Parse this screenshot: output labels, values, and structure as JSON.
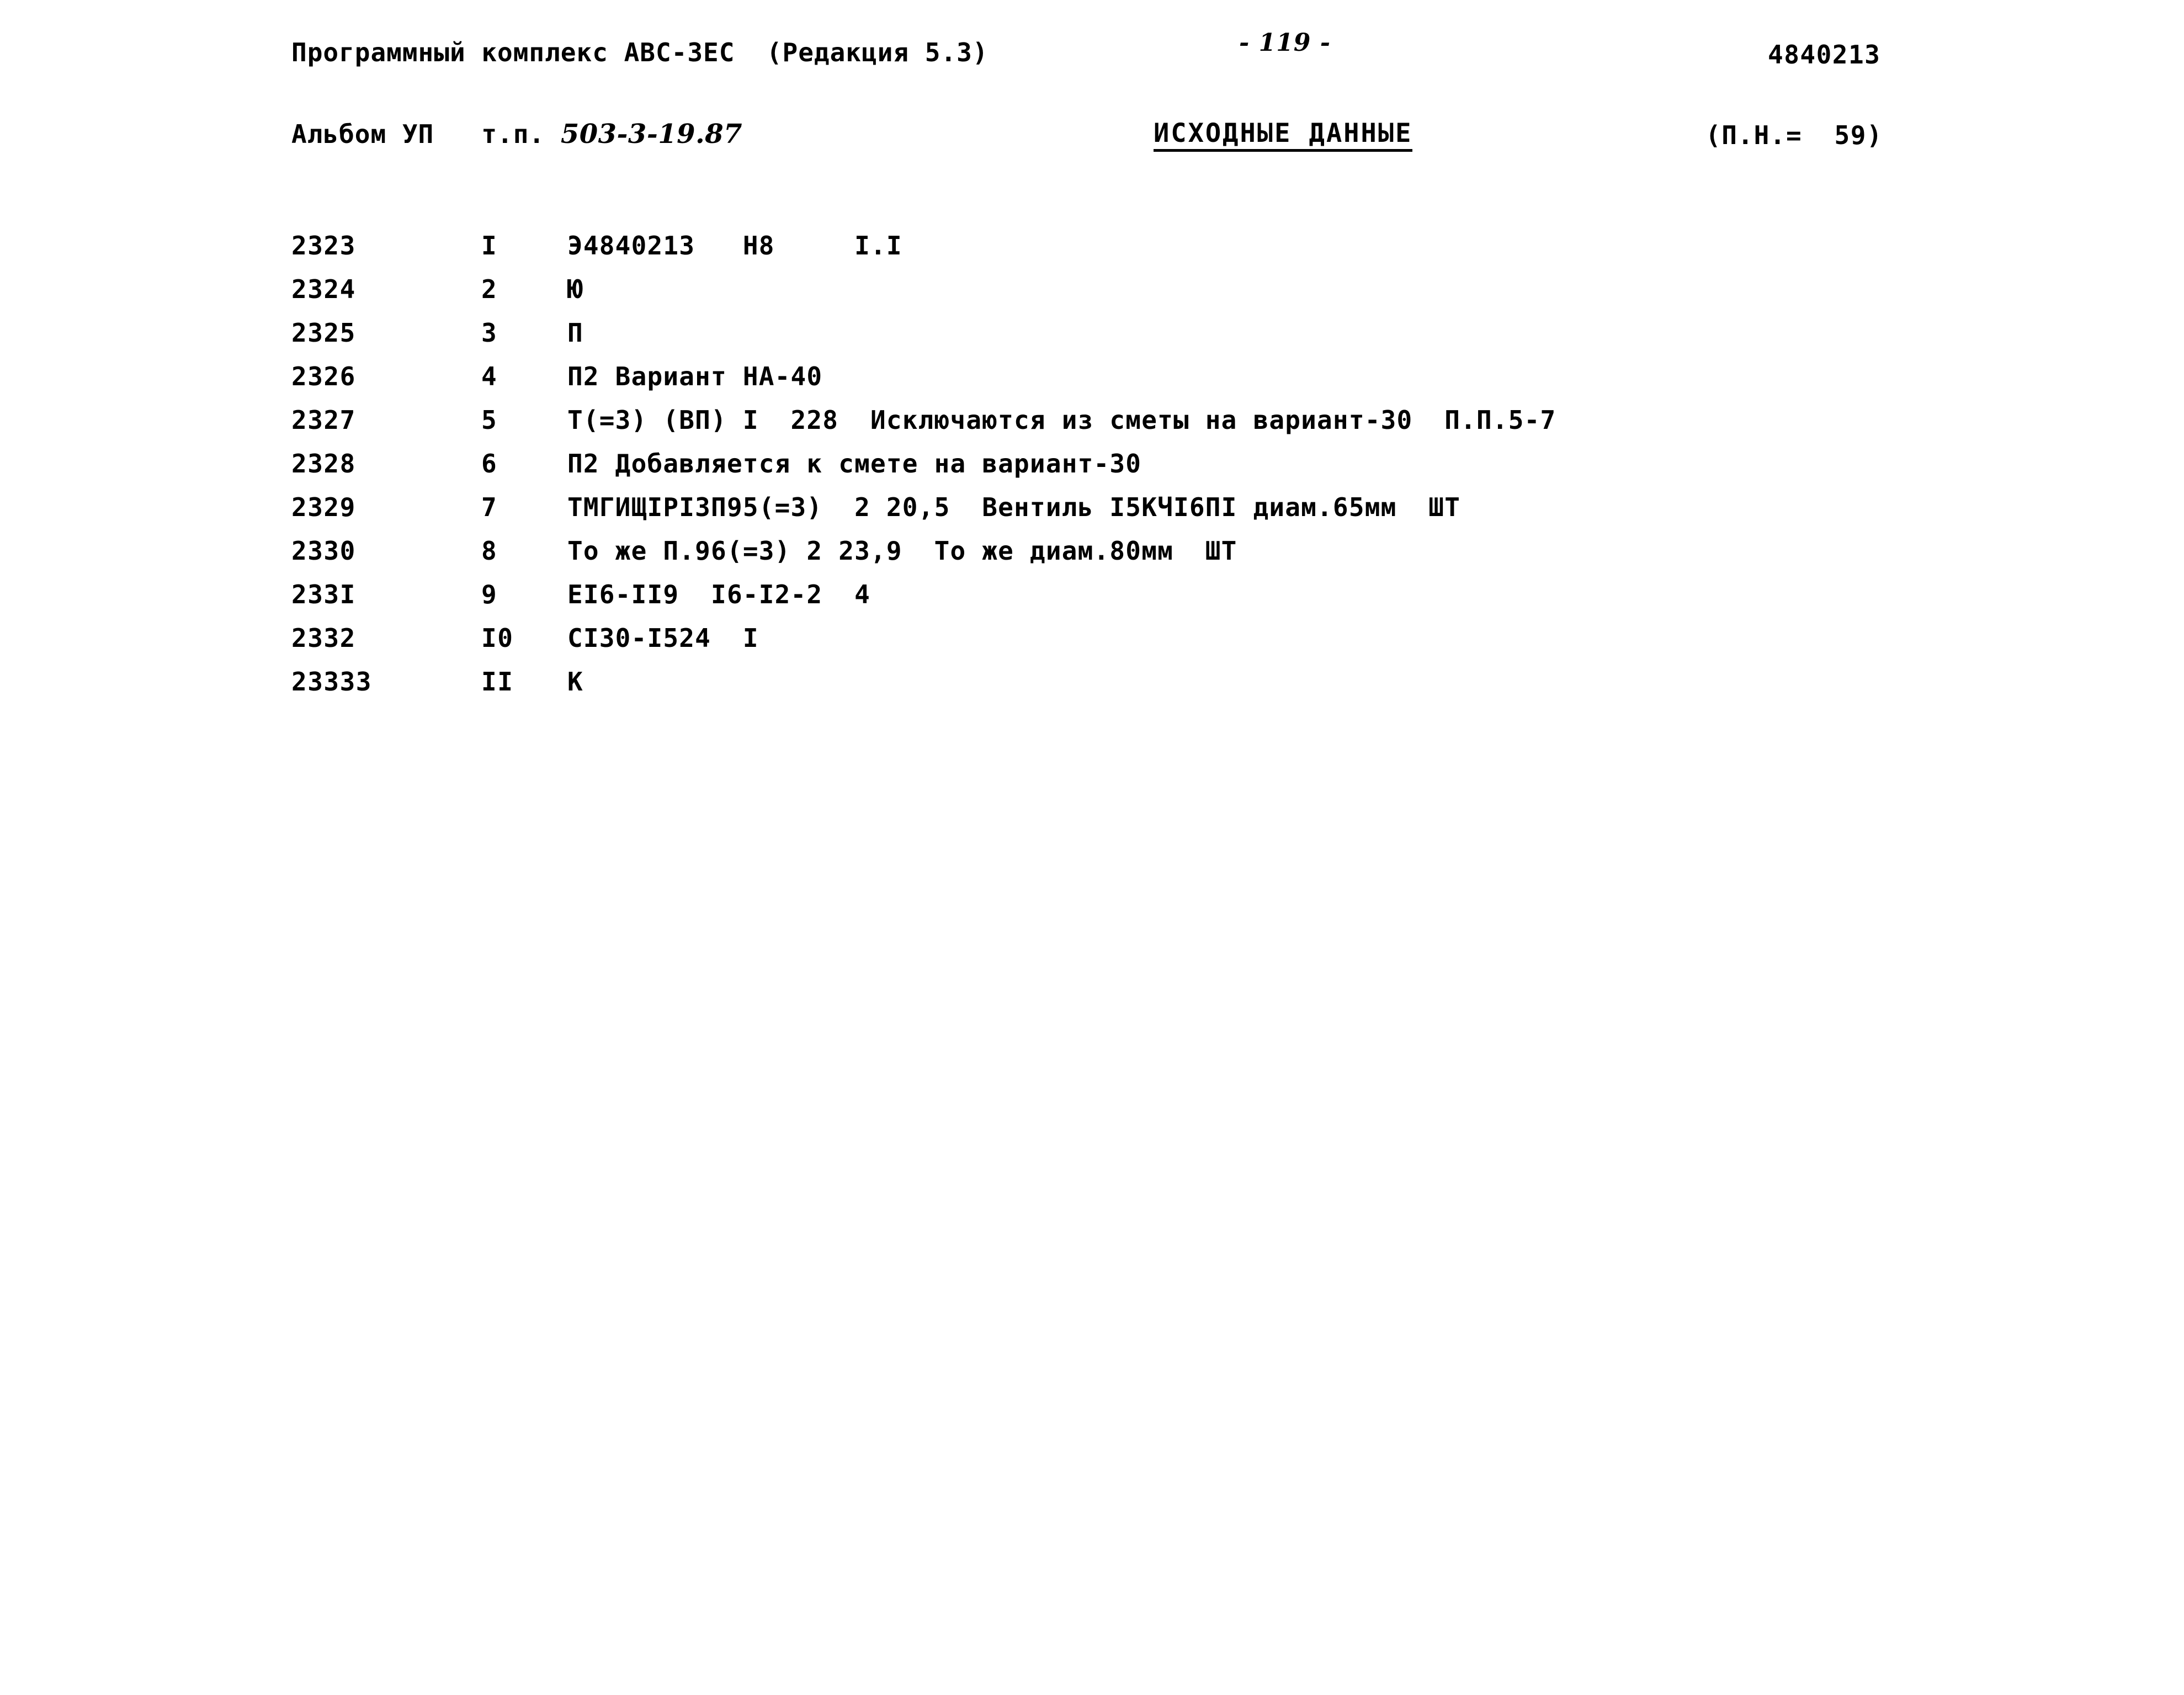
{
  "header": {
    "program_title": "Программный комплекс АВС-ЗЕС  (Редакция 5.3)",
    "page_number": "- 119 -",
    "document_code": "4840213",
    "album_label": "Альбом УП   т.п. ",
    "album_value": "503-3-19.87",
    "section_title": "ИСХОДНЫЕ ДАННЫЕ",
    "pn_value": "(П.Н.=  59)"
  },
  "table": {
    "rows": [
      {
        "seq": "2323",
        "num": "I",
        "content": "Э4840213   Н8     I.I"
      },
      {
        "seq": "2324",
        "num": "2",
        "content": "Ю"
      },
      {
        "seq": "2325",
        "num": "3",
        "content": "П"
      },
      {
        "seq": "2326",
        "num": "4",
        "content": "П2 Вариант НА-40"
      },
      {
        "seq": "2327",
        "num": "5",
        "content": "Т(=3) (ВП) I  228  Исключаются из сметы на вариант-30  П.П.5-7"
      },
      {
        "seq": "2328",
        "num": "6",
        "content": "П2 Добавляется к смете на вариант-30"
      },
      {
        "seq": "2329",
        "num": "7",
        "content": "ТМГИЩIРIЗП95(=3)  2 20,5  Вентиль I5КЧI6ПI диам.65мм  ШТ"
      },
      {
        "seq": "2330",
        "num": "8",
        "content": "То же П.96(=3) 2 23,9  То же диам.80мм  ШТ"
      },
      {
        "seq": "233I",
        "num": "9",
        "content": "ЕI6-II9  I6-I2-2  4"
      },
      {
        "seq": "2332",
        "num": "I0",
        "content": "СI30-I524  I"
      },
      {
        "seq": "23333",
        "num": "II",
        "content": "К"
      }
    ]
  }
}
